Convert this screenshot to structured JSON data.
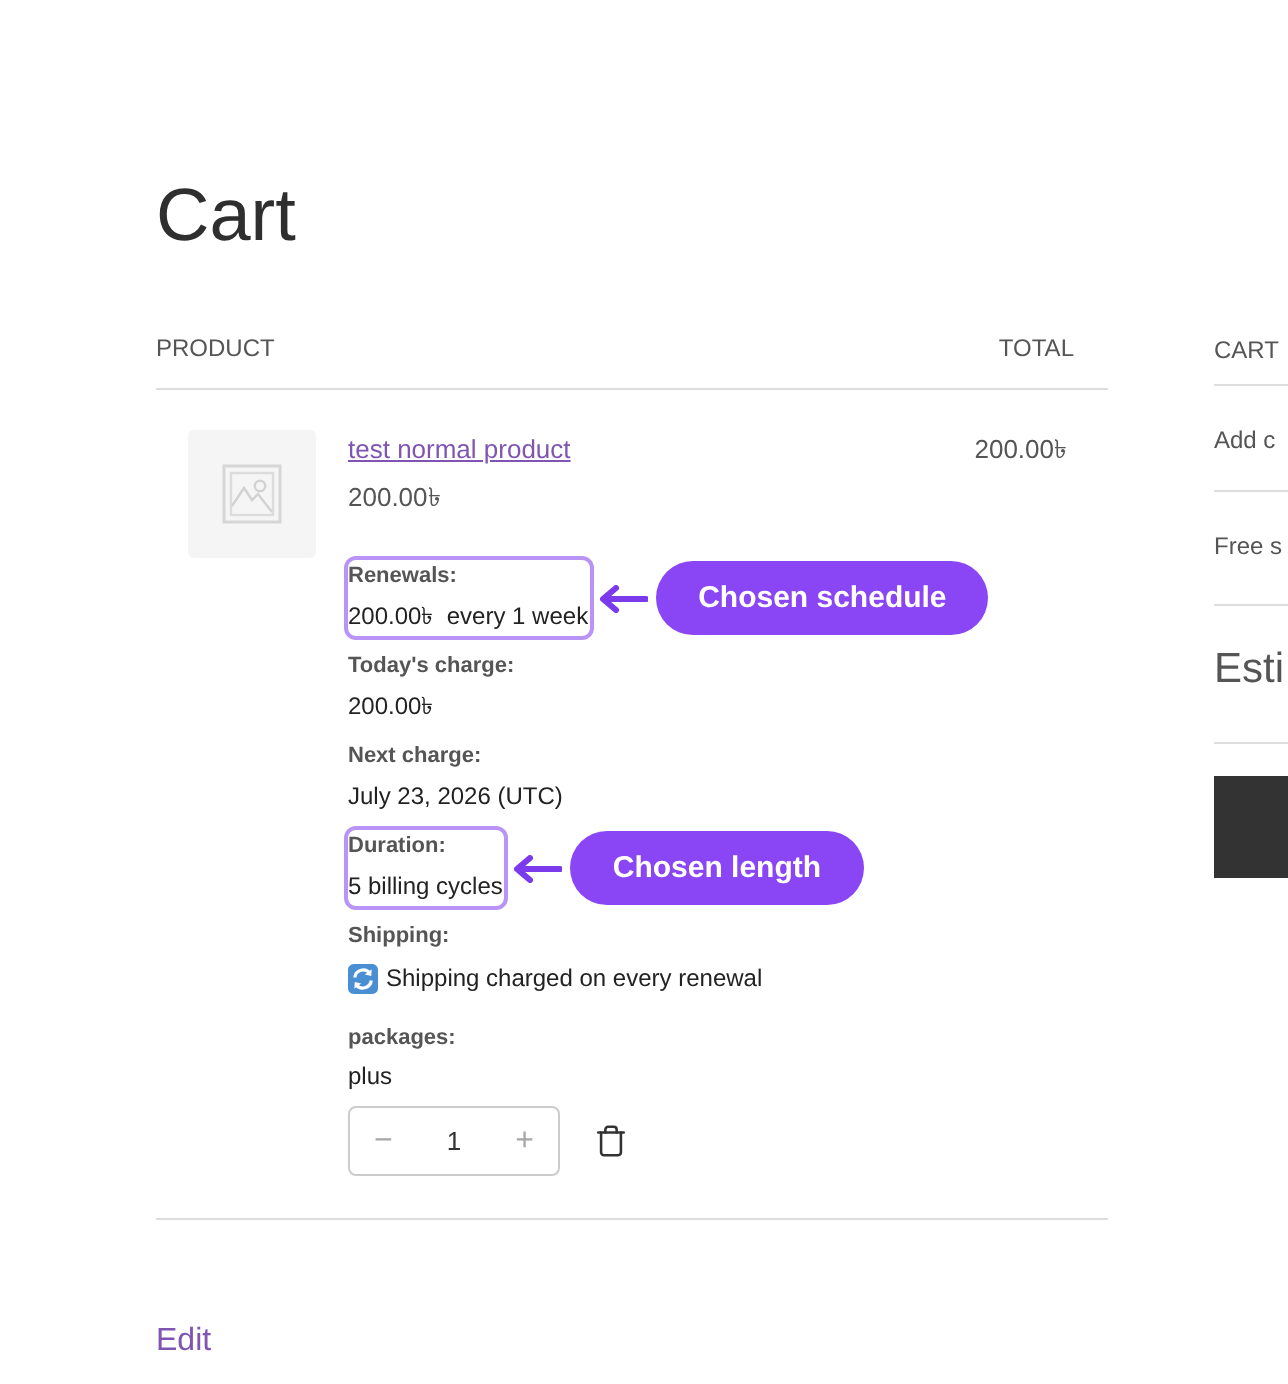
{
  "page": {
    "title": "Cart"
  },
  "cart_table": {
    "columns": [
      "PRODUCT",
      "TOTAL"
    ],
    "items": [
      {
        "name": "test normal product",
        "price": "200.00৳",
        "total": "200.00৳",
        "meta": [
          {
            "kind": "plain",
            "label": "Renewals:",
            "value": "200.00৳  every 1 week",
            "highlighted": true,
            "callout": "Chosen schedule"
          },
          {
            "kind": "plain",
            "label": "Today's charge:",
            "value": "200.00৳",
            "highlighted": false
          },
          {
            "kind": "plain",
            "label": "Next charge:",
            "value": "July 23, 2026 (UTC)",
            "highlighted": false
          },
          {
            "kind": "plain",
            "label": "Duration:",
            "value": "5 billing cycles",
            "highlighted": true,
            "callout": "Chosen length"
          },
          {
            "kind": "recurring",
            "label": "Shipping:",
            "value": "Shipping charged on every renewal",
            "highlighted": false
          }
        ],
        "attributes": [
          {
            "label": "packages:",
            "value": "plus"
          }
        ],
        "quantity": {
          "decrement": "−",
          "value": "1",
          "increment": "+"
        }
      }
    ]
  },
  "totals_sidebar": {
    "heading": "CART",
    "rows": [
      "Add c",
      "Free s"
    ],
    "subheading": "Esti"
  },
  "edit_link": "Edit"
}
